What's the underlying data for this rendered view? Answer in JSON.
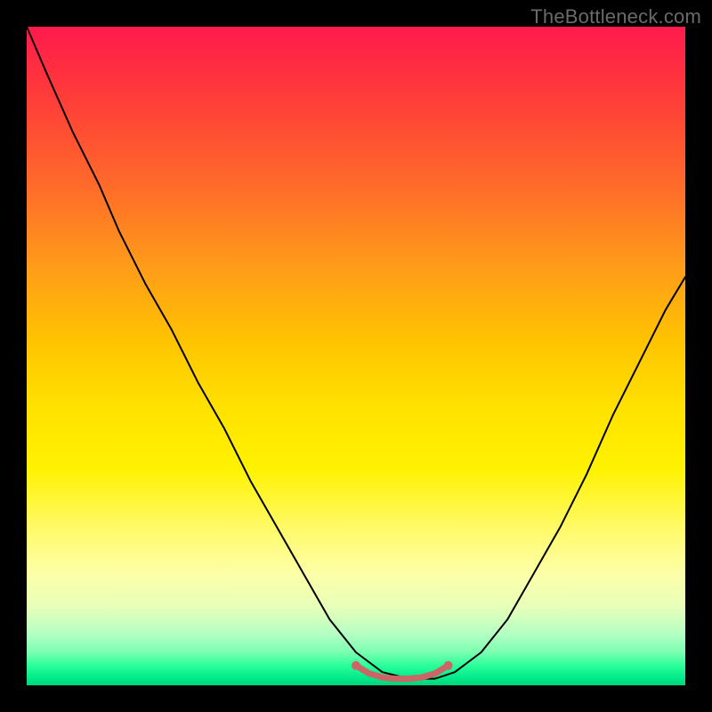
{
  "watermark": {
    "text": "TheBottleneck.com"
  },
  "chart_data": {
    "type": "line",
    "title": "",
    "xlabel": "",
    "ylabel": "",
    "xlim": [
      0,
      1
    ],
    "ylim": [
      0,
      1
    ],
    "grid": false,
    "legend": false,
    "series": [
      {
        "name": "bottleneck-curve",
        "stroke": "#000000",
        "stroke_width": 2,
        "x": [
          0.0,
          0.03,
          0.07,
          0.11,
          0.14,
          0.18,
          0.22,
          0.26,
          0.3,
          0.34,
          0.38,
          0.42,
          0.46,
          0.5,
          0.54,
          0.58,
          0.62,
          0.65,
          0.69,
          0.73,
          0.77,
          0.81,
          0.85,
          0.89,
          0.93,
          0.97,
          1.0
        ],
        "y": [
          1.0,
          0.93,
          0.84,
          0.76,
          0.69,
          0.61,
          0.54,
          0.46,
          0.39,
          0.31,
          0.24,
          0.17,
          0.1,
          0.05,
          0.02,
          0.01,
          0.01,
          0.02,
          0.05,
          0.1,
          0.17,
          0.24,
          0.32,
          0.41,
          0.49,
          0.57,
          0.62
        ]
      },
      {
        "name": "optimal-band",
        "stroke": "#cc6666",
        "stroke_width": 7,
        "x": [
          0.5,
          0.52,
          0.54,
          0.56,
          0.58,
          0.6,
          0.62,
          0.64
        ],
        "y": [
          0.03,
          0.018,
          0.012,
          0.01,
          0.01,
          0.012,
          0.018,
          0.03
        ]
      }
    ],
    "markers": [
      {
        "name": "optimal-left-dot",
        "x": 0.5,
        "y": 0.03,
        "r": 5,
        "fill": "#cc6666"
      },
      {
        "name": "optimal-right-dot",
        "x": 0.64,
        "y": 0.03,
        "r": 5,
        "fill": "#cc6666"
      }
    ],
    "background_gradient": {
      "direction": "vertical",
      "stops": [
        {
          "pos": 0.0,
          "color": "#ff1a4d"
        },
        {
          "pos": 0.5,
          "color": "#ffe200"
        },
        {
          "pos": 0.9,
          "color": "#b8ffc4"
        },
        {
          "pos": 1.0,
          "color": "#00d47a"
        }
      ]
    }
  }
}
